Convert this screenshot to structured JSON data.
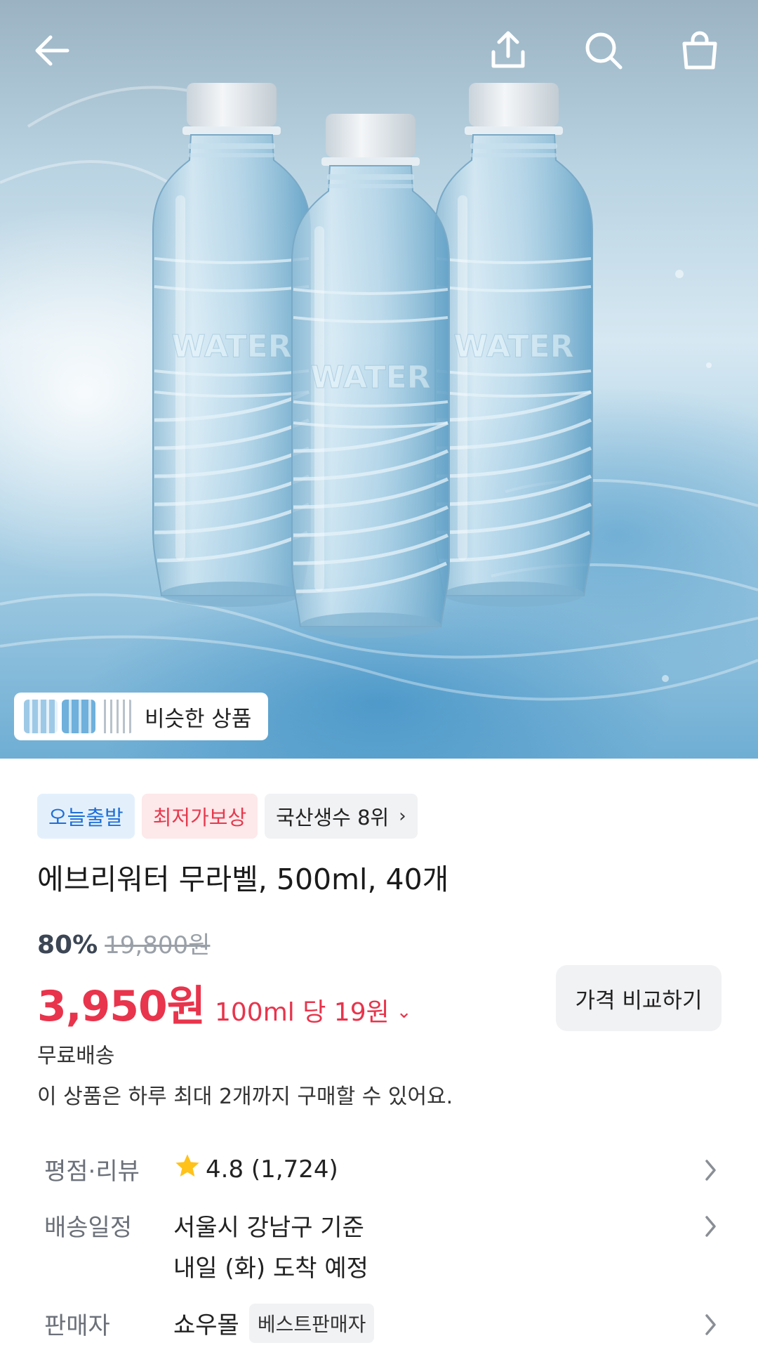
{
  "header": {
    "back_icon": "arrow-left-icon",
    "share_icon": "share-upload-icon",
    "search_icon": "search-icon",
    "cart_icon": "shopping-bag-icon"
  },
  "hero": {
    "bottle_embossing": "WATER",
    "similar_button_label": "비슷한 상품"
  },
  "badges": {
    "today_ship": "오늘출발",
    "lowest_price": "최저가보상",
    "ranking": "국산생수 8위"
  },
  "product": {
    "title": "에브리워터 무라벨, 500ml, 40개",
    "discount_rate": "80%",
    "original_price": "19,800원",
    "price": "3,950원",
    "unit_price": "100ml 당 19원",
    "compare_button": "가격 비교하기",
    "shipping": "무료배송",
    "purchase_limit": "이 상품은 하루 최대 2개까지 구매할 수 있어요."
  },
  "details": {
    "rating_label": "평점·리뷰",
    "rating_value": "4.8 (1,724)",
    "delivery_label": "배송일정",
    "delivery_region": "서울시 강남구 기준",
    "delivery_eta": "내일 (화) 도착 예정",
    "seller_label": "판매자",
    "seller_name": "쇼우몰",
    "seller_badge": "베스트판매자"
  },
  "colors": {
    "price_red": "#e8344c",
    "badge_blue": "#1f6fd6",
    "star_yellow": "#ffc21a"
  }
}
